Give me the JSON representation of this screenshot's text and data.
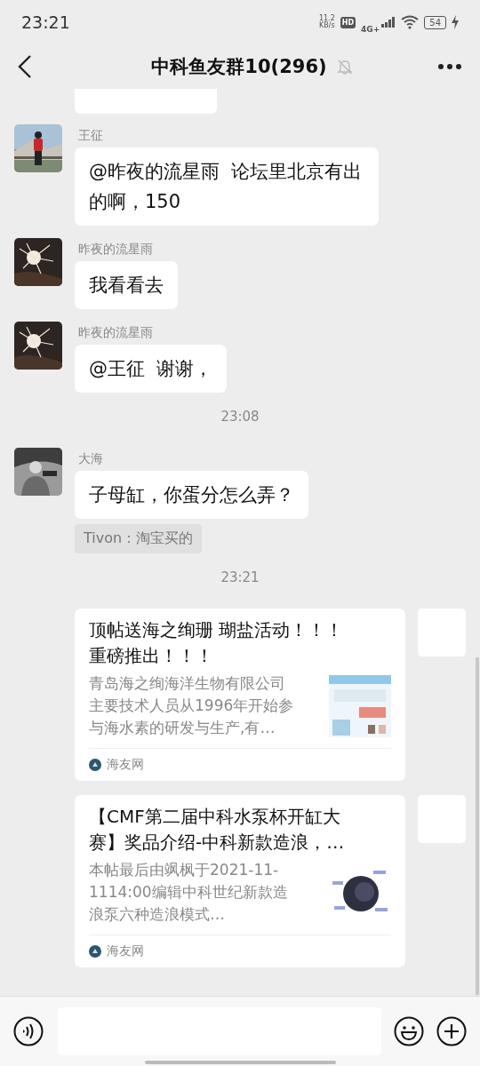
{
  "status_bar": {
    "time": "23:21",
    "net_speed": "11.2",
    "net_unit": "KB/s",
    "hd": "HD",
    "network": "4G+",
    "battery": "54",
    "charging": true
  },
  "header": {
    "title": "中科鱼友群10(296)",
    "muted": true
  },
  "messages": [
    {
      "kind": "cut"
    },
    {
      "kind": "text",
      "sender": "王征",
      "text": "@昨夜的流星雨  论坛里北京有出的啊，150"
    },
    {
      "kind": "text",
      "sender": "昨夜的流星雨",
      "text": "我看看去"
    },
    {
      "kind": "text",
      "sender": "昨夜的流星雨",
      "text": "@王征  谢谢，"
    },
    {
      "kind": "time",
      "text": "23:08"
    },
    {
      "kind": "text",
      "sender": "大海",
      "text": "子母缸，你蛋分怎么弄？",
      "quote": "Tivon：淘宝买的"
    },
    {
      "kind": "time",
      "text": "23:21"
    },
    {
      "kind": "card",
      "title": "顶帖送海之绚珊 瑚盐活动！！！重磅推出！！！",
      "description": "青岛海之绚海洋生物有限公司主要技术人员从1996年开始参与海水素的研发与生产,有…",
      "source": "海友网"
    },
    {
      "kind": "card",
      "title": "【CMF第二届中科水泵杯开缸大赛】奖品介绍-中科新款造浪，…",
      "description": "本帖最后由飒枫于2021-11-1114:00编辑中科世纪新款造浪泵六种造浪模式…",
      "source": "海友网"
    }
  ]
}
